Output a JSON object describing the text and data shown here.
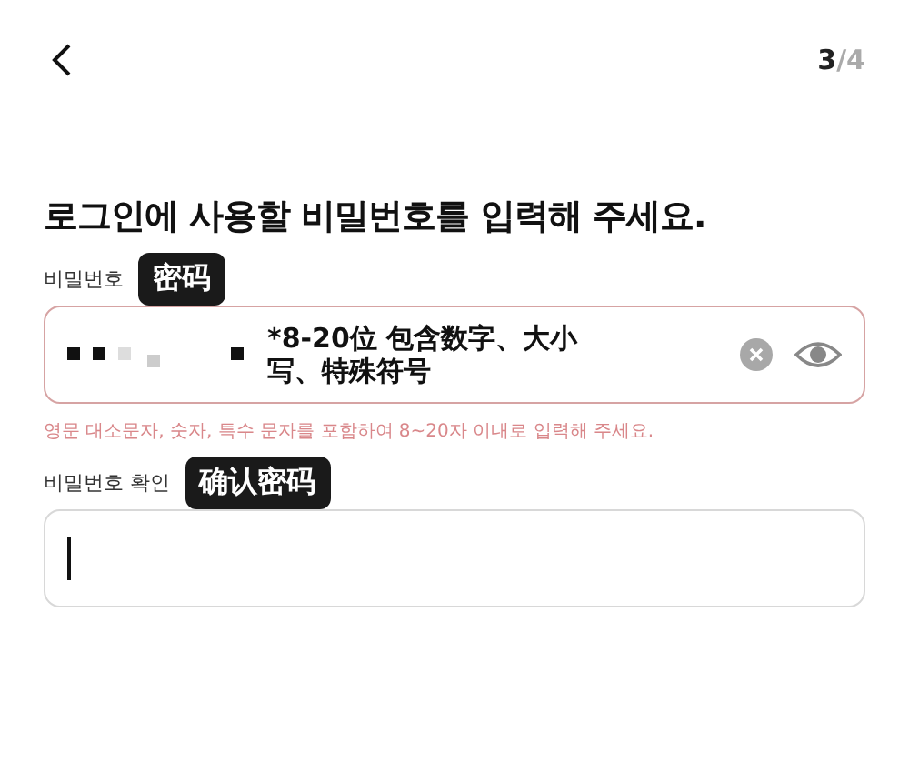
{
  "header": {
    "step_current": "3",
    "step_rest": "/4"
  },
  "heading": "로그인에 사용할 비밀번호를 입력해 주세요.",
  "fields": [
    {
      "label": "비밀번호",
      "tag": "密码",
      "masked": true,
      "note": "*8-20位 包含数字、大小写、特殊符号",
      "error": true,
      "focused": false,
      "clear_button": true,
      "reveal_button": true,
      "error_text": "영문 대소문자, 숫자, 특수 문자를 포함하여 8~20자 이내로 입력해 주세요."
    },
    {
      "label": "비밀번호 확인",
      "tag": "确认密码",
      "masked": false,
      "error": false,
      "focused": true,
      "clear_button": false,
      "reveal_button": false
    }
  ]
}
